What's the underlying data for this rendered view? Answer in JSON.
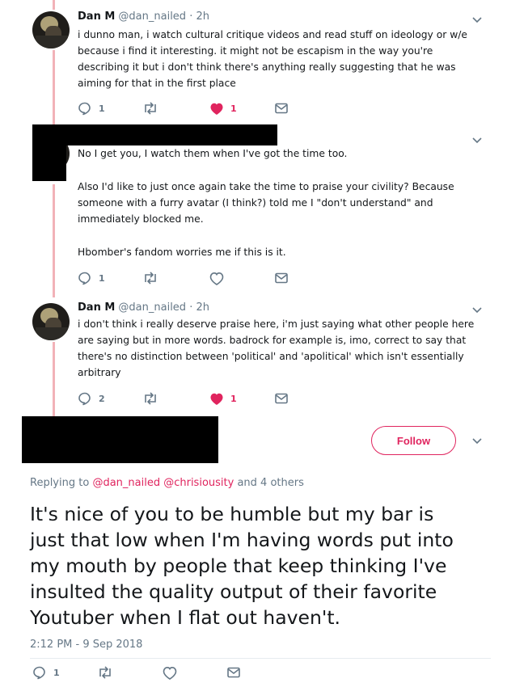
{
  "colors": {
    "accent": "#e0245e",
    "muted": "#657786",
    "text": "#14171a",
    "thread_line": "#f2b2b8"
  },
  "tweets": [
    {
      "name": "Dan M",
      "handle": "@dan_nailed",
      "dot": "·",
      "time": "2h",
      "paragraphs": [
        "i dunno man, i watch cultural critique videos and read stuff on ideology or w/e\nbecause i find it interesting. it might not be escapism in the way you're\ndescribing it but i don't think there's anything really suggesting that he was\naiming for that in the first place"
      ],
      "replies": "1",
      "retweets": "",
      "likes": "1",
      "liked": true
    },
    {
      "name": "",
      "handle": "",
      "paragraphs": [
        "No I get you, I watch them when I've got the time too.",
        "Also I'd like to just once again take the time to praise your civility? Because\nsomeone with a furry avatar (I think?) told me I \"don't understand\" and\nimmediately blocked me.",
        "Hbomber's fandom worries me if this is it."
      ],
      "replies": "1",
      "retweets": "",
      "likes": "",
      "liked": false
    },
    {
      "name": "Dan M",
      "handle": "@dan_nailed",
      "dot": "·",
      "time": "2h",
      "paragraphs": [
        "i don't think i really deserve praise here, i'm just saying what other people here\nare saying but in more words. badrock for example is, imo, correct to say that\nthere's no distinction between 'political' and 'apolitical' which isn't essentially\narbitrary"
      ],
      "replies": "2",
      "retweets": "",
      "likes": "1",
      "liked": true
    }
  ],
  "main_tweet": {
    "follow_label": "Follow",
    "replying_prefix": "Replying to",
    "mention_1": "@dan_nailed",
    "mention_2": "@chrisiousity",
    "replying_suffix": "and 4 others",
    "text": "It's nice of you to be humble but my bar is\njust that low when I'm having words put into\nmy mouth by people that keep thinking I've\ninsulted the quality output of their favorite\nYoutuber when I flat out haven't.",
    "timestamp": "2:12 PM - 9 Sep 2018",
    "replies": "1",
    "retweets": "",
    "likes": ""
  },
  "icons": {
    "reply": "reply-icon",
    "retweet": "retweet-icon",
    "like": "heart-icon",
    "dm": "mail-icon",
    "more": "chevron-down-icon"
  }
}
